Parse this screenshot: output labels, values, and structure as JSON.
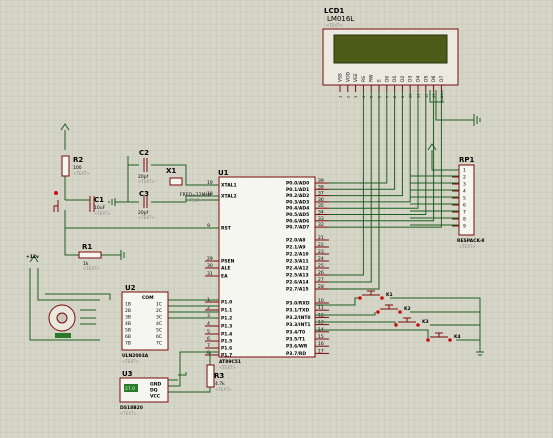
{
  "lcd": {
    "ref": "LCD1",
    "part": "LM016L",
    "hint": "<TEXT>",
    "pins": [
      "VSS",
      "VDD",
      "VEE",
      "RS",
      "RW",
      "E",
      "D0",
      "D1",
      "D2",
      "D3",
      "D4",
      "D5",
      "D6",
      "D7"
    ],
    "pin_numbers": [
      "1",
      "2",
      "3",
      "4",
      "5",
      "6",
      "7",
      "8",
      "9",
      "10",
      "11",
      "12",
      "13",
      "14"
    ]
  },
  "mcu": {
    "ref": "U1",
    "part": "AT89C51",
    "hint": "<TEXT>",
    "left_pins": [
      {
        "num": "19",
        "name": "XTAL1"
      },
      {
        "num": "18",
        "name": "XTAL2"
      },
      {
        "num": "9",
        "name": "RST"
      },
      {
        "num": "29",
        "name": "PSEN"
      },
      {
        "num": "30",
        "name": "ALE"
      },
      {
        "num": "31",
        "name": "EA"
      },
      {
        "num": "1",
        "name": "P1.0"
      },
      {
        "num": "2",
        "name": "P1.1"
      },
      {
        "num": "3",
        "name": "P1.2"
      },
      {
        "num": "4",
        "name": "P1.3"
      },
      {
        "num": "5",
        "name": "P1.4"
      },
      {
        "num": "6",
        "name": "P1.5"
      },
      {
        "num": "7",
        "name": "P1.6"
      },
      {
        "num": "8",
        "name": "P1.7"
      }
    ],
    "right_pins": [
      {
        "num": "39",
        "name": "P0.0/AD0"
      },
      {
        "num": "38",
        "name": "P0.1/AD1"
      },
      {
        "num": "37",
        "name": "P0.2/AD2"
      },
      {
        "num": "36",
        "name": "P0.3/AD3"
      },
      {
        "num": "35",
        "name": "P0.4/AD4"
      },
      {
        "num": "34",
        "name": "P0.5/AD5"
      },
      {
        "num": "33",
        "name": "P0.6/AD6"
      },
      {
        "num": "32",
        "name": "P0.7/AD7"
      },
      {
        "num": "21",
        "name": "P2.0/A8"
      },
      {
        "num": "22",
        "name": "P2.1/A9"
      },
      {
        "num": "23",
        "name": "P2.2/A10"
      },
      {
        "num": "24",
        "name": "P2.3/A11"
      },
      {
        "num": "25",
        "name": "P2.4/A12"
      },
      {
        "num": "26",
        "name": "P2.5/A13"
      },
      {
        "num": "27",
        "name": "P2.6/A14"
      },
      {
        "num": "28",
        "name": "P2.7/A15"
      },
      {
        "num": "10",
        "name": "P3.0/RXD"
      },
      {
        "num": "11",
        "name": "P3.1/TXD"
      },
      {
        "num": "12",
        "name": "P3.2/INT0"
      },
      {
        "num": "13",
        "name": "P3.3/INT1"
      },
      {
        "num": "14",
        "name": "P3.4/T0"
      },
      {
        "num": "15",
        "name": "P3.5/T1"
      },
      {
        "num": "16",
        "name": "P3.6/WR"
      },
      {
        "num": "17",
        "name": "P3.7/RD"
      }
    ]
  },
  "rp1": {
    "ref": "RP1",
    "part": "RESPACK-8",
    "hint": "<TEXT>",
    "pins": [
      "1",
      "2",
      "3",
      "4",
      "5",
      "6",
      "7",
      "8",
      "9"
    ]
  },
  "c1": {
    "ref": "C1",
    "value": "10uF",
    "hint": "<TEXT>"
  },
  "c2": {
    "ref": "C2",
    "value": "20pf",
    "hint": "<TEXT>"
  },
  "c3": {
    "ref": "C3",
    "value": "20pf",
    "hint": "<TEXT>"
  },
  "x1": {
    "ref": "X1",
    "value": "FREQ=12MHz",
    "hint": "<TEXT>"
  },
  "r1": {
    "ref": "R1",
    "value": "1k",
    "hint": "<TEXT>"
  },
  "r2": {
    "ref": "R2",
    "value": "100",
    "hint": "<TEXT>"
  },
  "r3": {
    "ref": "R3",
    "value": "4.7k",
    "hint": "<TEXT>"
  },
  "u2": {
    "ref": "U2",
    "part": "ULN2003A",
    "hint": "<TEXT>",
    "com": "COM",
    "left_pins": [
      "1B",
      "2B",
      "3B",
      "4B",
      "5B",
      "6B",
      "7B"
    ],
    "right_pins": [
      "1C",
      "2C",
      "3C",
      "4C",
      "5C",
      "6C",
      "7C"
    ]
  },
  "u3": {
    "ref": "U3",
    "part": "DS18B20",
    "hint": "<TEXT>",
    "pins": [
      "GND",
      "DQ",
      "VCC"
    ],
    "display": "27.0"
  },
  "supply": {
    "label": "+12v"
  },
  "keys": [
    {
      "ref": "K1"
    },
    {
      "ref": "K2"
    },
    {
      "ref": "K3"
    },
    {
      "ref": "K4"
    }
  ],
  "colors": {
    "background": "#d6d6c8",
    "grid": "#bdbdae",
    "wire": "#1c5e1c",
    "component": "#7a0a0a",
    "lcd_screen": "#4e5a18",
    "pin_dot": "#c81010"
  }
}
